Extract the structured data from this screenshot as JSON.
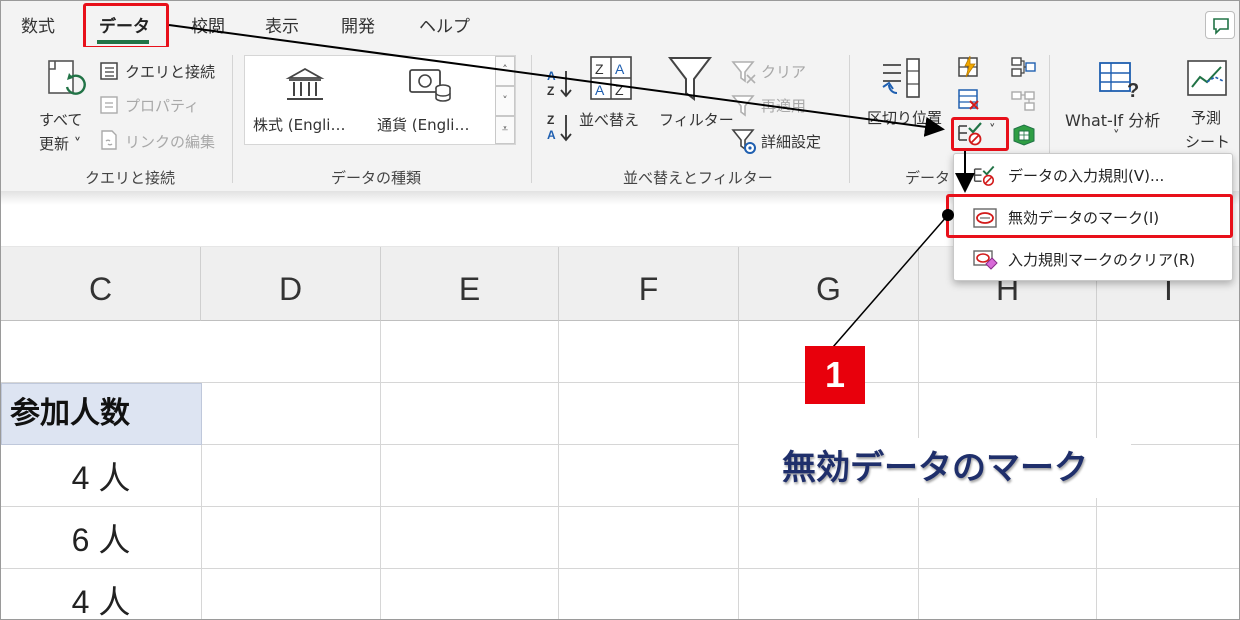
{
  "ribbon_tabs": [
    {
      "label": "数式",
      "active": false
    },
    {
      "label": "データ",
      "active": true
    },
    {
      "label": "校閲",
      "active": false
    },
    {
      "label": "表示",
      "active": false
    },
    {
      "label": "開発",
      "active": false
    },
    {
      "label": "ヘルプ",
      "active": false
    }
  ],
  "groups": {
    "queries": {
      "label": "クエリと接続",
      "refresh_all_line1": "すべて",
      "refresh_all_line2": "更新 ˅",
      "queries_connections": "クエリと接続",
      "properties": "プロパティ",
      "edit_links": "リンクの編集"
    },
    "data_types": {
      "label": "データの種類",
      "stocks": "株式 (Engli…",
      "currencies": "通貨 (Engli…"
    },
    "sort_filter": {
      "label": "並べ替えとフィルター",
      "sort": "並べ替え",
      "filter": "フィルター",
      "clear": "クリア",
      "reapply": "再適用",
      "advanced": "詳細設定"
    },
    "data_tools": {
      "label": "データ",
      "text_to_columns": "区切り位置"
    },
    "forecast": {
      "what_if": "What-If 分析",
      "what_if_arrow": "˅",
      "forecast_sheet_line1": "予測",
      "forecast_sheet_line2": "シート"
    }
  },
  "dropdown_menu": {
    "items": [
      {
        "label": "データの入力規則(V)..."
      },
      {
        "label": "無効データのマーク(I)"
      },
      {
        "label": "入力規則マークのクリア(R)"
      }
    ]
  },
  "columns": [
    "C",
    "D",
    "E",
    "F",
    "G",
    "H",
    "I"
  ],
  "sheet": {
    "header_cell": "参加人数",
    "values": [
      "4 人",
      "6 人",
      "4 人"
    ]
  },
  "annotations": {
    "step_number": "1",
    "callout_text": "無効データのマーク"
  },
  "colors": {
    "highlight_red": "#e8101a",
    "excel_green": "#217346",
    "callout_navy": "#1f2f6b",
    "header_cell_fill": "#dde4f2"
  }
}
